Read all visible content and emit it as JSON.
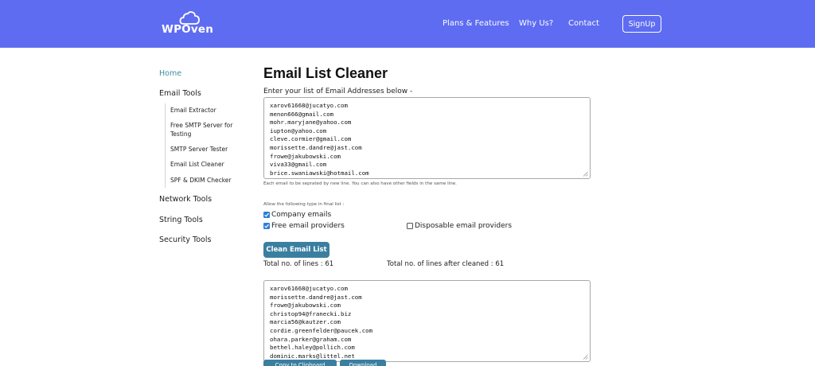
{
  "header": {
    "logo_text": "WPOven",
    "nav": [
      "Plans & Features",
      "Why Us?",
      "Contact"
    ],
    "signup_label": "SignUp",
    "bg_color": "#5e6cf2"
  },
  "sidebar": {
    "home": "Home",
    "email_tools": "Email Tools",
    "email_sub": [
      "Email Extractor",
      "Free SMTP Server for Testing",
      "SMTP Server Tester",
      "Email List Cleaner",
      "SPF & DKIM Checker"
    ],
    "network_tools": "Network Tools",
    "string_tools": "String Tools",
    "security_tools": "Security Tools"
  },
  "main": {
    "title": "Email List Cleaner",
    "instruction": "Enter your list of Email Addresses below -",
    "input_lines": [
      "xarov61668@jucatyo.com",
      "menon666@gmail.com",
      "mohr.maryjane@yahoo.com",
      "iupton@yahoo.com",
      "cleve.cormier@gmail.com",
      "morissette.dandre@jast.com",
      "frowe@jakubowski.com",
      "viva33@gmail.com",
      "brice.swaniawski@hotmail.com"
    ],
    "hint": "Each email to be seprated by new line. You can also have other fields in the same line.",
    "allow_label": "Allow the following type in final list :",
    "options": {
      "company": {
        "label": "Company emails",
        "checked": true
      },
      "free": {
        "label": "Free email providers",
        "checked": true
      },
      "disposable": {
        "label": "Disposable email providers",
        "checked": false
      }
    },
    "clean_button": "Clean Email List",
    "total_lines": "Total no. of lines : 61",
    "total_after": "Total no. of lines after cleaned : 61",
    "output_lines": [
      "xarov61668@jucatyo.com",
      "morissette.dandre@jast.com",
      "frowe@jakubowski.com",
      "christop94@franecki.biz",
      "marcia56@kautzer.com",
      "cordie.greenfelder@paucek.com",
      "ohara.parker@graham.com",
      "bethel.haley@pollich.com",
      "dominic.marks@littel.net"
    ],
    "copy_button": "Copy to Clipboard",
    "download_button": "Download",
    "accent_color": "#3b7fa0",
    "checkbox_color": "#2f7fd8"
  }
}
